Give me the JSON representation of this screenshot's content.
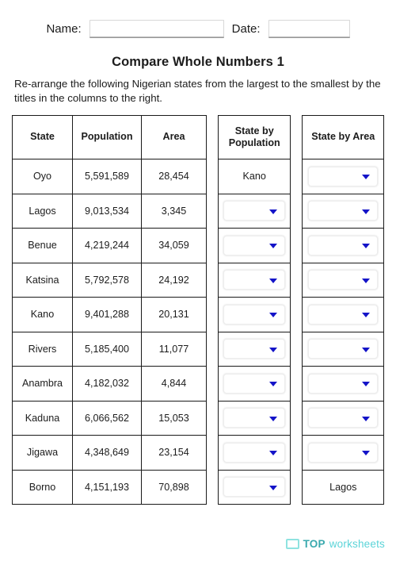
{
  "header": {
    "name_label": "Name:",
    "name_value": "",
    "name_placeholder": "",
    "date_label": "Date:",
    "date_value": "",
    "date_placeholder": ""
  },
  "title": "Compare Whole Numbers 1",
  "instructions": "Re-arrange the following Nigerian states from the largest to the smallest by the titles in the columns to the right.",
  "table": {
    "headers": {
      "state": "State",
      "population": "Population",
      "area": "Area",
      "state_by_population": "State by Population",
      "state_by_area": "State by Area"
    },
    "rows": [
      {
        "state": "Oyo",
        "population": "5,591,589",
        "area": "28,454"
      },
      {
        "state": "Lagos",
        "population": "9,013,534",
        "area": "3,345"
      },
      {
        "state": "Benue",
        "population": "4,219,244",
        "area": "34,059"
      },
      {
        "state": "Katsina",
        "population": "5,792,578",
        "area": "24,192"
      },
      {
        "state": "Kano",
        "population": "9,401,288",
        "area": "20,131"
      },
      {
        "state": "Rivers",
        "population": "5,185,400",
        "area": "11,077"
      },
      {
        "state": "Anambra",
        "population": "4,182,032",
        "area": "4,844"
      },
      {
        "state": "Kaduna",
        "population": "6,066,562",
        "area": "15,053"
      },
      {
        "state": "Jigawa",
        "population": "4,348,649",
        "area": "23,154"
      },
      {
        "state": "Borno",
        "population": "4,151,193",
        "area": "70,898"
      }
    ],
    "answers_by_population": [
      {
        "type": "text",
        "value": "Kano"
      },
      {
        "type": "dropdown",
        "value": ""
      },
      {
        "type": "dropdown",
        "value": ""
      },
      {
        "type": "dropdown",
        "value": ""
      },
      {
        "type": "dropdown",
        "value": ""
      },
      {
        "type": "dropdown",
        "value": ""
      },
      {
        "type": "dropdown",
        "value": ""
      },
      {
        "type": "dropdown",
        "value": ""
      },
      {
        "type": "dropdown",
        "value": ""
      },
      {
        "type": "dropdown",
        "value": ""
      }
    ],
    "answers_by_area": [
      {
        "type": "dropdown",
        "value": ""
      },
      {
        "type": "dropdown",
        "value": ""
      },
      {
        "type": "dropdown",
        "value": ""
      },
      {
        "type": "dropdown",
        "value": ""
      },
      {
        "type": "dropdown",
        "value": ""
      },
      {
        "type": "dropdown",
        "value": ""
      },
      {
        "type": "dropdown",
        "value": ""
      },
      {
        "type": "dropdown",
        "value": ""
      },
      {
        "type": "dropdown",
        "value": ""
      },
      {
        "type": "text",
        "value": "Lagos"
      }
    ]
  },
  "footer": {
    "logo_top": "TOP",
    "logo_worksheets": "worksheets"
  },
  "colors": {
    "caret_blue": "#1414c8",
    "logo_teal_dark": "#3aa9ae",
    "logo_teal_light": "#5bd4d8",
    "border_black": "#1a1a1a"
  }
}
